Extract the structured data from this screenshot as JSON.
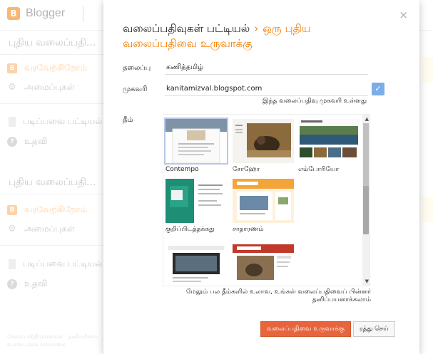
{
  "background": {
    "brand": "Blogger",
    "logo_letter": "B",
    "sections": [
      {
        "title": "புதிய வலைப்பதி...",
        "welcome": "வரவேற்கிறோம்",
        "settings": "அமைப்புகள்",
        "reading_list": "படிப்பவை பட்டியல்",
        "help": "உதவி"
      },
      {
        "title": "புதிய வலைப்பதி...",
        "welcome": "வரவேற்கிறோம்",
        "settings": "அமைப்புகள்",
        "reading_list": "படிப்பவை பட்டியல்",
        "help": "உதவி"
      }
    ],
    "footer_line1": "சேவை விதிமுறைகள் · தனியுரிமை",
    "footer_line2": "உள்ளடக்கக் கொள்கை"
  },
  "dialog": {
    "close": "×",
    "breadcrumb_parent": "வலைப்பதிவுகள் பட்டியல்",
    "breadcrumb_sep": "›",
    "breadcrumb_current": "ஒரு புதிய வலைப்பதிவை உருவாக்கு",
    "title_label": "தலைப்பு",
    "title_value": "கணித்தமிழ்",
    "address_label": "முகவரி",
    "address_value": "kanitamizval.blogspot.com",
    "address_hint": "இந்த வலைப்பதிவு முகவரி உள்ளது",
    "theme_label": "தீம்",
    "themes": [
      {
        "name": "Contempo"
      },
      {
        "name": "சோஹோ"
      },
      {
        "name": "எம்போரியோ"
      },
      {
        "name": "குறிப்பிடத்தக்கது"
      },
      {
        "name": "சாதாரணம்"
      },
      {
        "name": ""
      },
      {
        "name": ""
      }
    ],
    "description": "மேலும் பல தீம்களில் உலாவ, உங்கள் வலைப்பதிவைப் பின்னர் தனிப்பயனாக்கலாம்",
    "create_button": "வலைப்பதிவை உருவாக்கு",
    "cancel_button": "ரத்து செய்"
  },
  "colors": {
    "accent": "#f57d00",
    "create_button": "#e8643c",
    "check": "#7baee8"
  }
}
